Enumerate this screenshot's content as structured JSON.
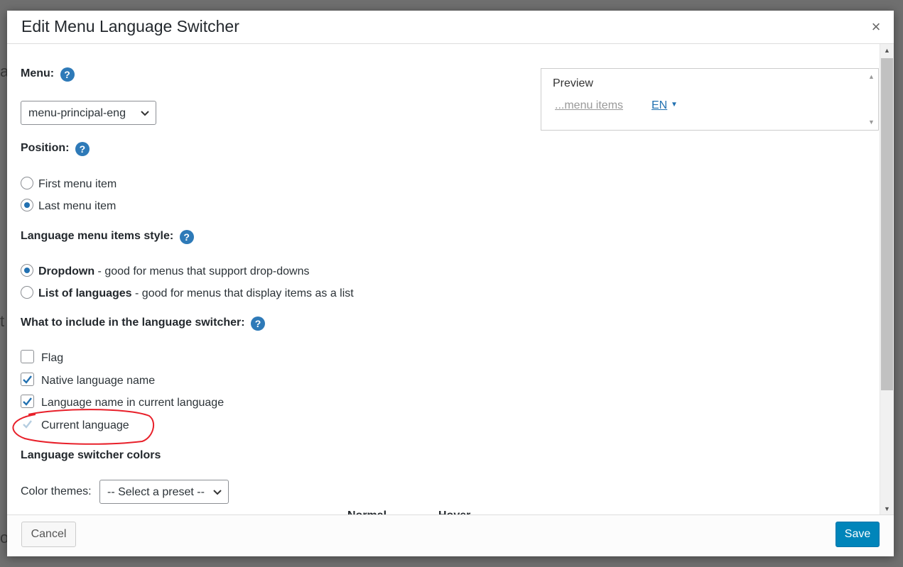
{
  "backdrop": [
    "a",
    "t",
    "o"
  ],
  "dialog": {
    "title": "Edit Menu Language Switcher",
    "close_symbol": "×"
  },
  "menu": {
    "label": "Menu:",
    "selected": "menu-principal-eng"
  },
  "help_symbol": "?",
  "position": {
    "label": "Position:",
    "options": [
      {
        "label": "First menu item",
        "selected": false
      },
      {
        "label": "Last menu item",
        "selected": true
      }
    ]
  },
  "style": {
    "label": "Language menu items style:",
    "options": [
      {
        "name": "Dropdown",
        "desc": " - good for menus that support drop-downs",
        "selected": true
      },
      {
        "name": "List of languages",
        "desc": " - good for menus that display items as a list",
        "selected": false
      }
    ]
  },
  "include": {
    "label": "What to include in the language switcher:",
    "options": [
      {
        "label": "Flag",
        "checked": false,
        "disabled": false
      },
      {
        "label": "Native language name",
        "checked": true,
        "disabled": false
      },
      {
        "label": "Language name in current language",
        "checked": true,
        "disabled": false
      },
      {
        "label": "Current language",
        "checked": true,
        "disabled": true
      }
    ]
  },
  "colors": {
    "label": "Language switcher colors",
    "themes_label": "Color themes:",
    "preset": "-- Select a preset --",
    "columns": [
      "Normal",
      "Hover"
    ]
  },
  "preview": {
    "title": "Preview",
    "items": "...menu items",
    "lang": "EN"
  },
  "footer": {
    "cancel": "Cancel",
    "save": "Save"
  },
  "icons": {
    "help": "help-icon",
    "chevron": "chevron-down-icon",
    "check": "checkmark-icon"
  },
  "annotation_color": "#e8202a"
}
